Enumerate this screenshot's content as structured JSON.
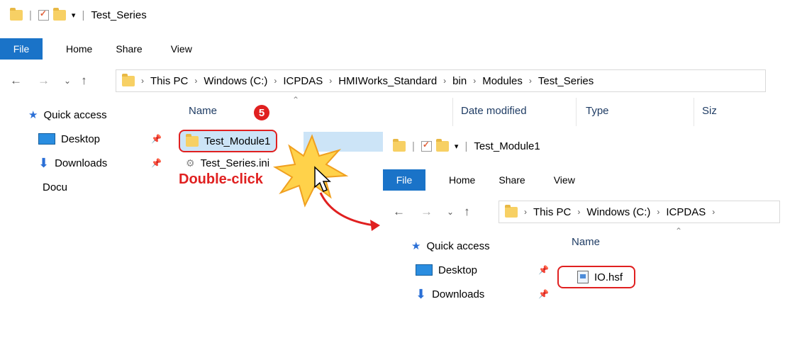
{
  "window1": {
    "title": "Test_Series",
    "ribbon": [
      "File",
      "Home",
      "Share",
      "View"
    ],
    "breadcrumbs": [
      "This PC",
      "Windows (C:)",
      "ICPDAS",
      "HMIWorks_Standard",
      "bin",
      "Modules",
      "Test_Series"
    ],
    "nav": {
      "quick_access": "Quick access",
      "items": [
        "Desktop",
        "Downloads",
        "Docu"
      ]
    },
    "columns": [
      "Name",
      "Date modified",
      "Type",
      "Siz"
    ],
    "files": [
      "Test_Module1",
      "Test_Series.ini"
    ]
  },
  "window2": {
    "title": "Test_Module1",
    "ribbon": [
      "File",
      "Home",
      "Share",
      "View"
    ],
    "breadcrumbs": [
      "This PC",
      "Windows (C:)",
      "ICPDAS"
    ],
    "nav": {
      "quick_access": "Quick access",
      "items": [
        "Desktop",
        "Downloads"
      ]
    },
    "columns": [
      "Name"
    ],
    "files": [
      "IO.hsf"
    ]
  },
  "annotation": {
    "step": "5",
    "action": "Double-click",
    "color": "#e02020"
  }
}
